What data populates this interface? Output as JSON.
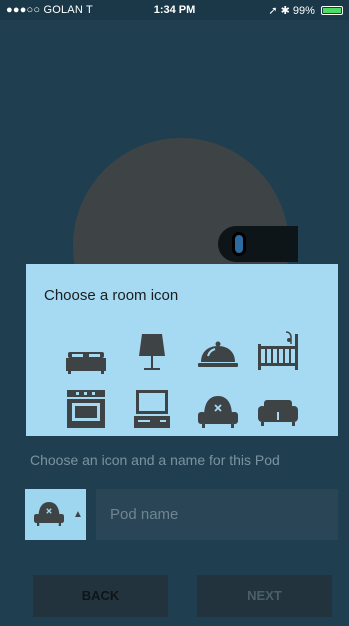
{
  "status_bar": {
    "carrier": "●●●○○ GOLAN T",
    "time": "1:34 PM",
    "battery": "99%",
    "signal_icons": "➚ ✱"
  },
  "popup": {
    "title": "Choose a room icon",
    "icons": [
      "bed-icon",
      "lamp-icon",
      "cloche-icon",
      "crib-icon",
      "oven-icon",
      "computer-icon",
      "armchair-icon",
      "sofa-icon"
    ]
  },
  "form": {
    "caption": "Choose an icon and a name for this Pod",
    "pod_name_placeholder": "Pod name",
    "selected_icon": "armchair-icon"
  },
  "buttons": {
    "back": "BACK",
    "next": "NEXT"
  },
  "colors": {
    "background": "#1f3f50",
    "popup": "#a6d9f2",
    "icon": "#3e4446"
  }
}
